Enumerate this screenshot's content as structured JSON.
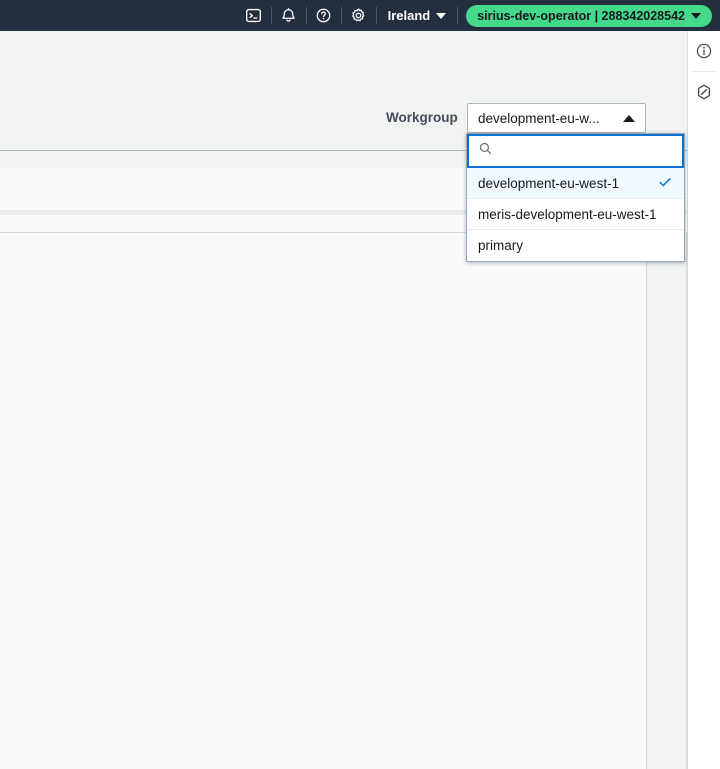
{
  "topnav": {
    "icons": [
      {
        "name": "cloudshell-icon",
        "label": "CloudShell"
      },
      {
        "name": "notifications-bell-icon",
        "label": "Notifications"
      },
      {
        "name": "help-question-icon",
        "label": "Help"
      },
      {
        "name": "settings-gear-icon",
        "label": "Settings"
      }
    ],
    "region": "Ireland",
    "account": "sirius-dev-operator | 288342028542",
    "account_color": "#44d88b",
    "bar_color": "#232f3e"
  },
  "rail": {
    "items": [
      {
        "name": "info-panel-icon",
        "label": "Info"
      },
      {
        "name": "amazon-q-icon",
        "label": "Amazon Q"
      }
    ]
  },
  "workgroup": {
    "label": "Workgroup",
    "selected": "development-eu-west-1",
    "trigger_text": "development-eu-w...",
    "expanded": true,
    "search_value": "",
    "search_placeholder": "",
    "options": [
      {
        "label": "development-eu-west-1",
        "selected": true
      },
      {
        "label": "meris-development-eu-west-1",
        "selected": false
      },
      {
        "label": "primary",
        "selected": false
      }
    ],
    "accent_color": "#0972d3",
    "highlight_color": "#f1faff"
  }
}
